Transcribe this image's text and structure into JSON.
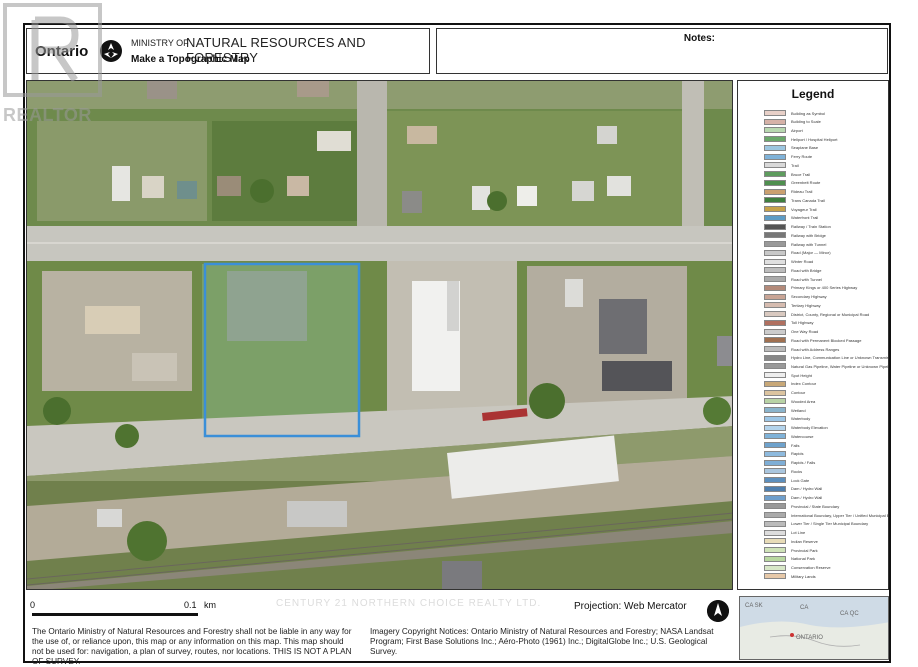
{
  "header": {
    "brand": "Ontario",
    "ministry_prefix": "MINISTRY OF",
    "ministry_name": "NATURAL RESOURCES AND FORESTRY",
    "map_title": "Make a Topographic Map"
  },
  "notes": {
    "label": "Notes:"
  },
  "watermarks": {
    "realtor": "REALTOR",
    "brokerage": "CENTURY 21 NORTHERN CHOICE REALTY LTD."
  },
  "legend": {
    "title": "Legend",
    "items": [
      {
        "label": "Building as Symbol",
        "color": "#e8d0c8"
      },
      {
        "label": "Building to Scale",
        "color": "#d6b2a8"
      },
      {
        "label": "Airport",
        "color": "#b8d8b0"
      },
      {
        "label": "Heliport / Hospital Heliport",
        "color": "#6aa86a"
      },
      {
        "label": "Seaplane Base",
        "color": "#9cc6e0"
      },
      {
        "label": "Ferry Route",
        "color": "#7fb2d8"
      },
      {
        "label": "Trail",
        "color": "#d9d9d9"
      },
      {
        "label": "Bruce Trail",
        "color": "#5e9c5e"
      },
      {
        "label": "Greenbelt Route",
        "color": "#4f8f4f"
      },
      {
        "label": "Rideau Trail",
        "color": "#caa070"
      },
      {
        "label": "Trans Canada Trail",
        "color": "#3f7f3f"
      },
      {
        "label": "Voyageur Trail",
        "color": "#c6a24a"
      },
      {
        "label": "Waterfront Trail",
        "color": "#5d9cc6"
      },
      {
        "label": "Railway / Train Station",
        "color": "#555555"
      },
      {
        "label": "Railway with Bridge",
        "color": "#777777"
      },
      {
        "label": "Railway with Tunnel",
        "color": "#999999"
      },
      {
        "label": "Road (Major — Minor)",
        "color": "#c9c9c9"
      },
      {
        "label": "Winter Road",
        "color": "#e0e0e0"
      },
      {
        "label": "Road with Bridge",
        "color": "#bdbdbd"
      },
      {
        "label": "Road with Tunnel",
        "color": "#aaaaaa"
      },
      {
        "label": "Primary Kings or 400 Series Highway",
        "color": "#b38a7a"
      },
      {
        "label": "Secondary Highway",
        "color": "#c9a596"
      },
      {
        "label": "Tertiary Highway",
        "color": "#d6bcb0"
      },
      {
        "label": "District, County, Regional or Municipal Road",
        "color": "#d9c9c0"
      },
      {
        "label": "Toll Highway",
        "color": "#b07060"
      },
      {
        "label": "One Way Road",
        "color": "#cccccc"
      },
      {
        "label": "Road with Permanent Blocked Passage",
        "color": "#a07050"
      },
      {
        "label": "Road with Address Ranges",
        "color": "#bbbbbb"
      },
      {
        "label": "Hydro Line, Communication Line or Unknown Transmission Line",
        "color": "#888888"
      },
      {
        "label": "Natural Gas Pipeline, Water Pipeline or Unknown Pipeline",
        "color": "#999999"
      },
      {
        "label": "Spot Height",
        "color": "#eeeeee"
      },
      {
        "label": "Index Contour",
        "color": "#c8a878"
      },
      {
        "label": "Contour",
        "color": "#dcc4a0"
      },
      {
        "label": "Wooded Area",
        "color": "#b9d3a6"
      },
      {
        "label": "Wetland",
        "color": "#8ab4cc"
      },
      {
        "label": "Waterbody",
        "color": "#9cc6e6"
      },
      {
        "label": "Waterbody Elevation",
        "color": "#b4d4ec"
      },
      {
        "label": "Watercourse",
        "color": "#7fb2d8"
      },
      {
        "label": "Falls",
        "color": "#6ea2cc"
      },
      {
        "label": "Rapids",
        "color": "#8ebade"
      },
      {
        "label": "Rapids / Falls",
        "color": "#7eaed6"
      },
      {
        "label": "Rocks",
        "color": "#aac6de"
      },
      {
        "label": "Lock Gate",
        "color": "#5d8fbd"
      },
      {
        "label": "Dam / Hydro Wall",
        "color": "#4f7fae"
      },
      {
        "label": "Dam / Hydro Wall",
        "color": "#6f9fcc"
      },
      {
        "label": "Provincial / State Boundary",
        "color": "#999999"
      },
      {
        "label": "International Boundary, Upper Tier / Unified Municipal Boundary",
        "color": "#aaaaaa"
      },
      {
        "label": "Lower Tier / Single Tier Municipal Boundary",
        "color": "#bbbbbb"
      },
      {
        "label": "Lot Line",
        "color": "#dddddd"
      },
      {
        "label": "Indian Reserve",
        "color": "#e8dcb8"
      },
      {
        "label": "Provincial Park",
        "color": "#cfe3b8"
      },
      {
        "label": "National Park",
        "color": "#b8d8a0"
      },
      {
        "label": "Conservation Reserve",
        "color": "#d8e8c8"
      },
      {
        "label": "Military Lands",
        "color": "#e6c8a8"
      }
    ]
  },
  "scale": {
    "start": "0",
    "end": "0.1",
    "unit": "km"
  },
  "projection": "Projection: Web Mercator",
  "disclaimer": "The Ontario Ministry of Natural Resources and Forestry shall not be liable in any way for the use of, or reliance upon, this map or any information on this map. This map should not be used for: navigation, a plan of survey, routes, nor locations. THIS IS NOT A PLAN OF SURVEY.",
  "imagery_notice": "Imagery Copyright Notices: Ontario Ministry of Natural Resources and Forestry; NASA Landsat Program; First Base Solutions Inc.; Aéro-Photo (1961) Inc.; DigitalGlobe Inc.; U.S. Geological Survey.",
  "inset_map": {
    "labels": [
      "CA SK",
      "CA",
      "CA QC",
      "ONTARIO"
    ]
  },
  "colors": {
    "parcel_outline": "#3a8fd8",
    "map_green": "#6f8f4a",
    "road": "#c8c8c4"
  }
}
